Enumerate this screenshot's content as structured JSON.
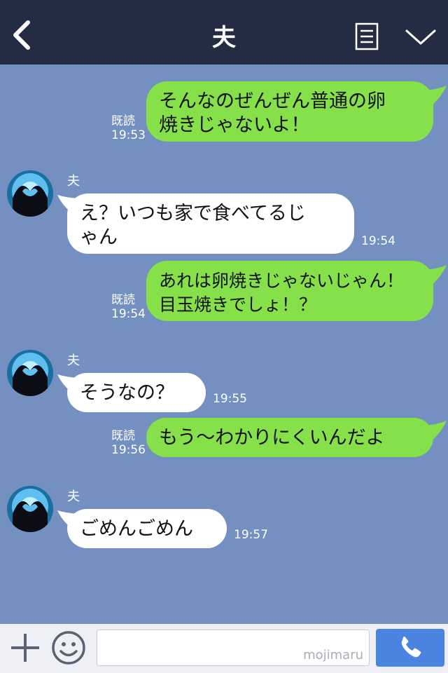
{
  "header": {
    "title": "夫",
    "back_icon": "chevron-left-icon",
    "menu_icon": "memo-icon",
    "collapse_icon": "chevron-down-icon"
  },
  "messages": [
    {
      "side": "out",
      "lines": [
        "そんなのぜんぜん普通の卵",
        "焼きじゃないよ！"
      ],
      "read": "既読",
      "time": "19:53"
    },
    {
      "side": "in",
      "sender": "夫",
      "lines": [
        "え？いつも家で食べてるじ",
        "ゃん"
      ],
      "time": "19:54"
    },
    {
      "side": "out",
      "lines": [
        "あれは卵焼きじゃないじゃん！",
        "目玉焼きでしょ！？"
      ],
      "read": "既読",
      "time": "19:54"
    },
    {
      "side": "in",
      "sender": "夫",
      "lines": [
        "そうなの？"
      ],
      "time": "19:55"
    },
    {
      "side": "out",
      "lines": [
        "もう〜わかりにくいんだよ"
      ],
      "read": "既読",
      "time": "19:56"
    },
    {
      "side": "in",
      "sender": "夫",
      "lines": [
        "ごめんごめん"
      ],
      "time": "19:57"
    }
  ],
  "input": {
    "placeholder": "",
    "watermark": "mojimaru",
    "plus_icon": "plus-icon",
    "emoji_icon": "emoji-icon",
    "call_icon": "phone-icon"
  },
  "colors": {
    "header_bg": "#232c43",
    "chat_bg": "#7490c0",
    "outgoing_bubble": "#86e04a",
    "incoming_bubble": "#ffffff",
    "call_button": "#4a84e0"
  }
}
